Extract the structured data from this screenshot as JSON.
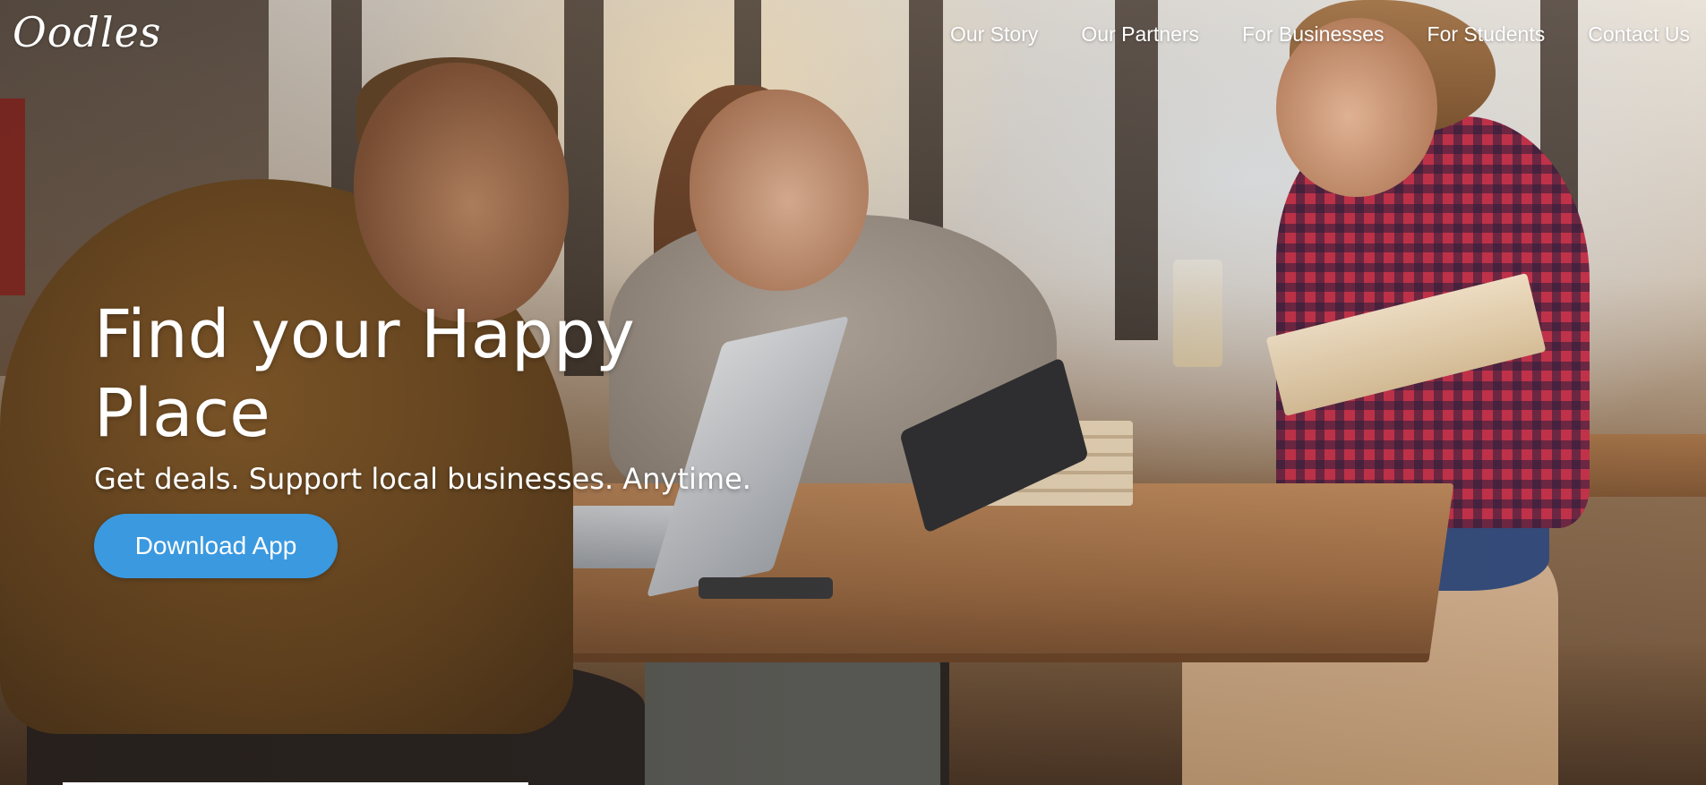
{
  "brand": {
    "logo_text": "Oodles"
  },
  "nav": {
    "items": [
      {
        "label": "Our Story"
      },
      {
        "label": "Our Partners"
      },
      {
        "label": "For Businesses"
      },
      {
        "label": "For Students"
      },
      {
        "label": "Contact Us"
      }
    ]
  },
  "hero": {
    "headline": "Find your Happy Place",
    "subtitle": "Get deals. Support local businesses. Anytime.",
    "cta_label": "Download App"
  },
  "colors": {
    "cta_background": "#3b99e0",
    "text": "#ffffff"
  }
}
